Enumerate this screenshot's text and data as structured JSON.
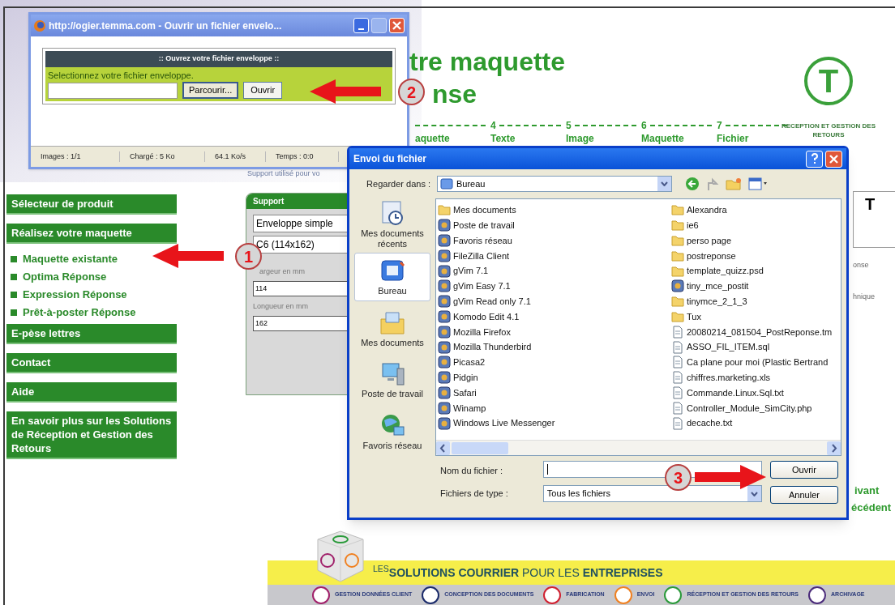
{
  "page": {
    "heading_lines": [
      "tre maquette",
      "nse"
    ],
    "steps": [
      {
        "label": "aquette"
      },
      {
        "number": "4",
        "label": "Texte"
      },
      {
        "number": "5",
        "label": "Image"
      },
      {
        "number": "6",
        "label": "Maquette"
      },
      {
        "number": "7",
        "label": "Fichier"
      }
    ],
    "logo": {
      "letter": "T",
      "caption": "RECEPTION ET GESTION DES RETOURS"
    },
    "support_note": "Support utilisé pour vo",
    "right_fragments": [
      {
        "kind": "card",
        "text": "T"
      },
      {
        "kind": "note",
        "text": "onse"
      },
      {
        "kind": "note",
        "text": "hnique"
      },
      {
        "kind": "link",
        "text": "ivant"
      },
      {
        "kind": "link",
        "text": "écédent"
      }
    ]
  },
  "nav": [
    {
      "label": "Sélecteur de produit",
      "kind": "bar"
    },
    {
      "label": "Réalisez votre maquette",
      "kind": "bar"
    },
    {
      "label": "Maquette existante",
      "kind": "link"
    },
    {
      "label": "Optima Réponse",
      "kind": "link"
    },
    {
      "label": "Expression Réponse",
      "kind": "link"
    },
    {
      "label": "Prêt-à-poster Réponse",
      "kind": "link"
    },
    {
      "label": "E-pèse lettres",
      "kind": "bar"
    },
    {
      "label": "Contact",
      "kind": "bar"
    },
    {
      "label": "Aide",
      "kind": "bar"
    },
    {
      "label": "En savoir plus sur les Solutions de Réception et Gestion des Retours",
      "kind": "bar"
    }
  ],
  "support_panel": {
    "title": "Support",
    "type_select": "Enveloppe simple",
    "format_select": "C6 (114x162)",
    "width_label": "argeur en mm",
    "width_value": "114",
    "length_label": "Longueur en mm",
    "length_value": "162"
  },
  "popup": {
    "title": "http://ogier.temma.com - Ouvrir un fichier envelo...",
    "header": ":: Ouvrez votre fichier enveloppe ::",
    "prompt": "Selectionnez votre fichier enveloppe.",
    "browse_button": "Parcourir...",
    "open_button": "Ouvrir",
    "status_bar": [
      "Images : 1/1",
      "Chargé : 5 Ko",
      "64.1 Ko/s",
      "Temps : 0:0"
    ]
  },
  "dialog": {
    "title": "Envoi du fichier",
    "look_in_label": "Regarder dans :",
    "look_in_value": "Bureau",
    "places": [
      {
        "label": "Mes documents récents",
        "kind": "recent",
        "selected": false
      },
      {
        "label": "Bureau",
        "kind": "desktop",
        "selected": true
      },
      {
        "label": "Mes documents",
        "kind": "documents",
        "selected": false
      },
      {
        "label": "Poste de travail",
        "kind": "computer",
        "selected": false
      },
      {
        "label": "Favoris réseau",
        "kind": "network",
        "selected": false
      }
    ],
    "files": [
      {
        "name": "Mes documents",
        "kind": "folder"
      },
      {
        "name": "Poste de travail",
        "kind": "program"
      },
      {
        "name": "Favoris réseau",
        "kind": "program"
      },
      {
        "name": "FileZilla Client",
        "kind": "program"
      },
      {
        "name": "gVim 7.1",
        "kind": "program"
      },
      {
        "name": "gVim Easy 7.1",
        "kind": "program"
      },
      {
        "name": "gVim Read only 7.1",
        "kind": "program"
      },
      {
        "name": "Komodo Edit 4.1",
        "kind": "program"
      },
      {
        "name": "Mozilla Firefox",
        "kind": "program"
      },
      {
        "name": "Mozilla Thunderbird",
        "kind": "program"
      },
      {
        "name": "Picasa2",
        "kind": "program"
      },
      {
        "name": "Pidgin",
        "kind": "program"
      },
      {
        "name": "Safari",
        "kind": "program"
      },
      {
        "name": "Winamp",
        "kind": "program"
      },
      {
        "name": "Windows Live Messenger",
        "kind": "program"
      },
      {
        "name": "Alexandra",
        "kind": "folder"
      },
      {
        "name": "ie6",
        "kind": "folder"
      },
      {
        "name": "perso page",
        "kind": "folder"
      },
      {
        "name": "postreponse",
        "kind": "folder"
      },
      {
        "name": "template_quizz.psd",
        "kind": "folder"
      },
      {
        "name": "tiny_mce_postit",
        "kind": "program"
      },
      {
        "name": "tinymce_2_1_3",
        "kind": "folder"
      },
      {
        "name": "Tux",
        "kind": "folder"
      },
      {
        "name": "20080214_081504_PostReponse.tm",
        "kind": "file"
      },
      {
        "name": "ASSO_FIL_ITEM.sql",
        "kind": "file"
      },
      {
        "name": "Ca plane pour moi (Plastic Bertrand",
        "kind": "file"
      },
      {
        "name": "chiffres.marketing.xls",
        "kind": "file"
      },
      {
        "name": "Commande.Linux.Sql.txt",
        "kind": "file"
      },
      {
        "name": "Controller_Module_SimCity.php",
        "kind": "file"
      },
      {
        "name": "decache.txt",
        "kind": "file"
      }
    ],
    "filename_label": "Nom du fichier :",
    "filetype_label": "Fichiers de type :",
    "filetype_value": "Tous les fichiers",
    "buttons": [
      "Ouvrir",
      "Annuler"
    ]
  },
  "callouts": [
    {
      "number": "1"
    },
    {
      "number": "2"
    },
    {
      "number": "3"
    }
  ],
  "footer": {
    "banner": "$^{LES}$**SOLUTIONS COURRIER** POUR LES **ENTREPRISES**",
    "services": [
      {
        "label": "GESTION DONNÉES CLIENT",
        "color": "#a0206a"
      },
      {
        "label": "CONCEPTION DES DOCUMENTS",
        "color": "#1a2a6a"
      },
      {
        "label": "FABRICATION",
        "color": "#d02030"
      },
      {
        "label": "ENVOI",
        "color": "#f08020"
      },
      {
        "label": "RÉCEPTION ET GESTION DES RETOURS",
        "color": "#2a9a3a"
      },
      {
        "label": "ARCHIVAGE",
        "color": "#4a2a7a"
      }
    ]
  }
}
